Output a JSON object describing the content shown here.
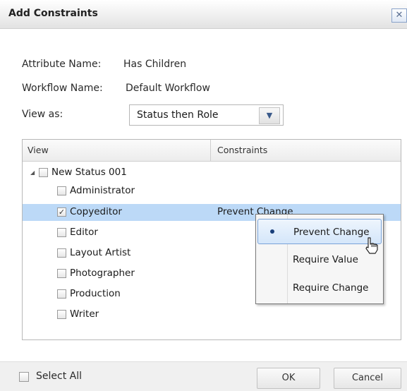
{
  "window": {
    "title": "Add Constraints",
    "close_glyph": "✕"
  },
  "form": {
    "attribute_label": "Attribute Name:",
    "attribute_value": "Has Children",
    "workflow_label": "Workflow Name:",
    "workflow_value": "Default Workflow",
    "view_as_label": "View as:",
    "view_as_value": "Status then Role"
  },
  "table": {
    "columns": [
      "View",
      "Constraints"
    ],
    "group": {
      "label": "New Status 001",
      "checked": false,
      "expanded": true
    },
    "rows": [
      {
        "label": "Administrator",
        "checked": false,
        "constraint": ""
      },
      {
        "label": "Copyeditor",
        "checked": true,
        "constraint": "Prevent Change",
        "selected": true
      },
      {
        "label": "Editor",
        "checked": false,
        "constraint": ""
      },
      {
        "label": "Layout Artist",
        "checked": false,
        "constraint": ""
      },
      {
        "label": "Photographer",
        "checked": false,
        "constraint": ""
      },
      {
        "label": "Production",
        "checked": false,
        "constraint": ""
      },
      {
        "label": "Writer",
        "checked": false,
        "constraint": ""
      }
    ]
  },
  "menu": {
    "items": [
      {
        "label": "Prevent Change",
        "selected": true
      },
      {
        "label": "Require Value",
        "selected": false
      },
      {
        "label": "Require Change",
        "selected": false
      }
    ]
  },
  "footer": {
    "select_all_label": "Select All",
    "ok_label": "OK",
    "cancel_label": "Cancel"
  },
  "colors": {
    "selection": "#bcd9f7",
    "menu_highlight": "#d4e6fa"
  },
  "icons": {
    "close": "close-icon",
    "dropdown": "chevron-down-icon",
    "expander": "triangle-down-icon",
    "cursor": "hand-pointer-icon"
  }
}
